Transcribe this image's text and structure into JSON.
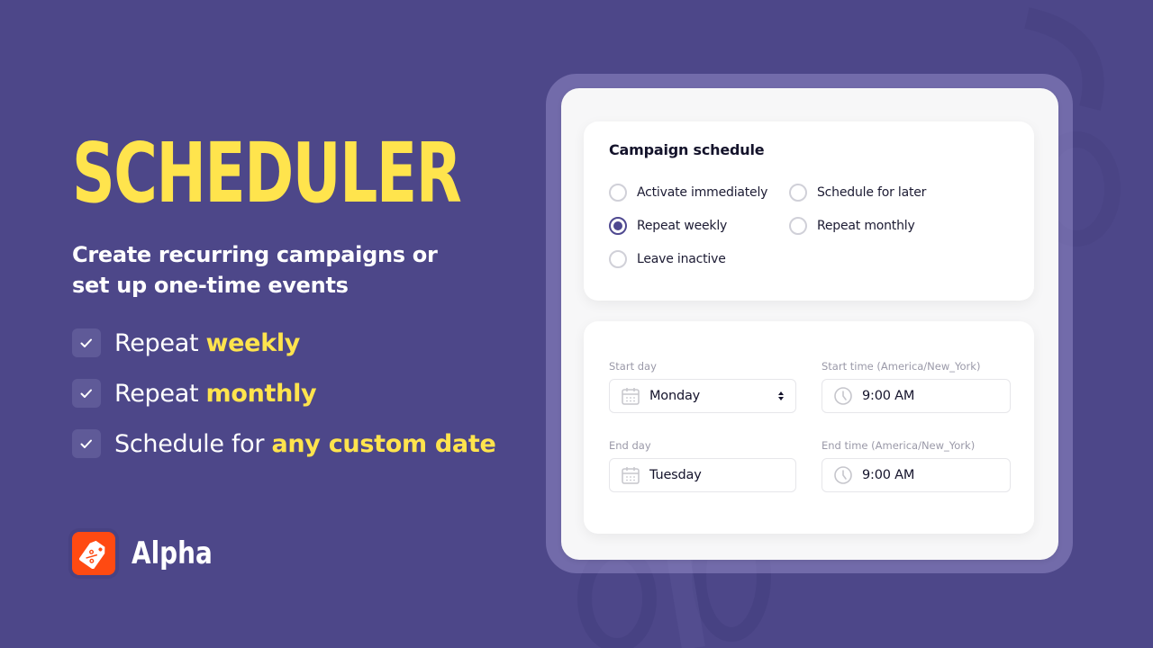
{
  "hero": {
    "title": "SCHEDULER",
    "subtitle": "Create recurring campaigns or set up one-time events",
    "features": [
      {
        "prefix": "Repeat ",
        "highlight": "weekly"
      },
      {
        "prefix": "Repeat ",
        "highlight": "monthly"
      },
      {
        "prefix": "Schedule for ",
        "highlight": "any custom date"
      }
    ]
  },
  "brand": {
    "name": "Alpha",
    "logo_icon": "price-tag-percent-icon"
  },
  "colors": {
    "background": "#4d4789",
    "accent_yellow": "#ffe44d",
    "brand_orange": "#ff4a12",
    "radio_selected": "#4f4990"
  },
  "schedule_card": {
    "title": "Campaign schedule",
    "options": [
      {
        "label": "Activate immediately",
        "selected": false
      },
      {
        "label": "Schedule for later",
        "selected": false
      },
      {
        "label": "Repeat weekly",
        "selected": true
      },
      {
        "label": "Repeat monthly",
        "selected": false
      },
      {
        "label": "Leave inactive",
        "selected": false
      }
    ]
  },
  "timing_card": {
    "start_day": {
      "label": "Start day",
      "value": "Monday",
      "icon": "calendar-icon"
    },
    "start_time": {
      "label": "Start time (America/New_York)",
      "value": "9:00 AM",
      "icon": "clock-icon"
    },
    "end_day": {
      "label": "End day",
      "value": "Tuesday",
      "icon": "calendar-icon"
    },
    "end_time": {
      "label": "End time (America/New_York)",
      "value": "9:00 AM",
      "icon": "clock-icon"
    }
  }
}
